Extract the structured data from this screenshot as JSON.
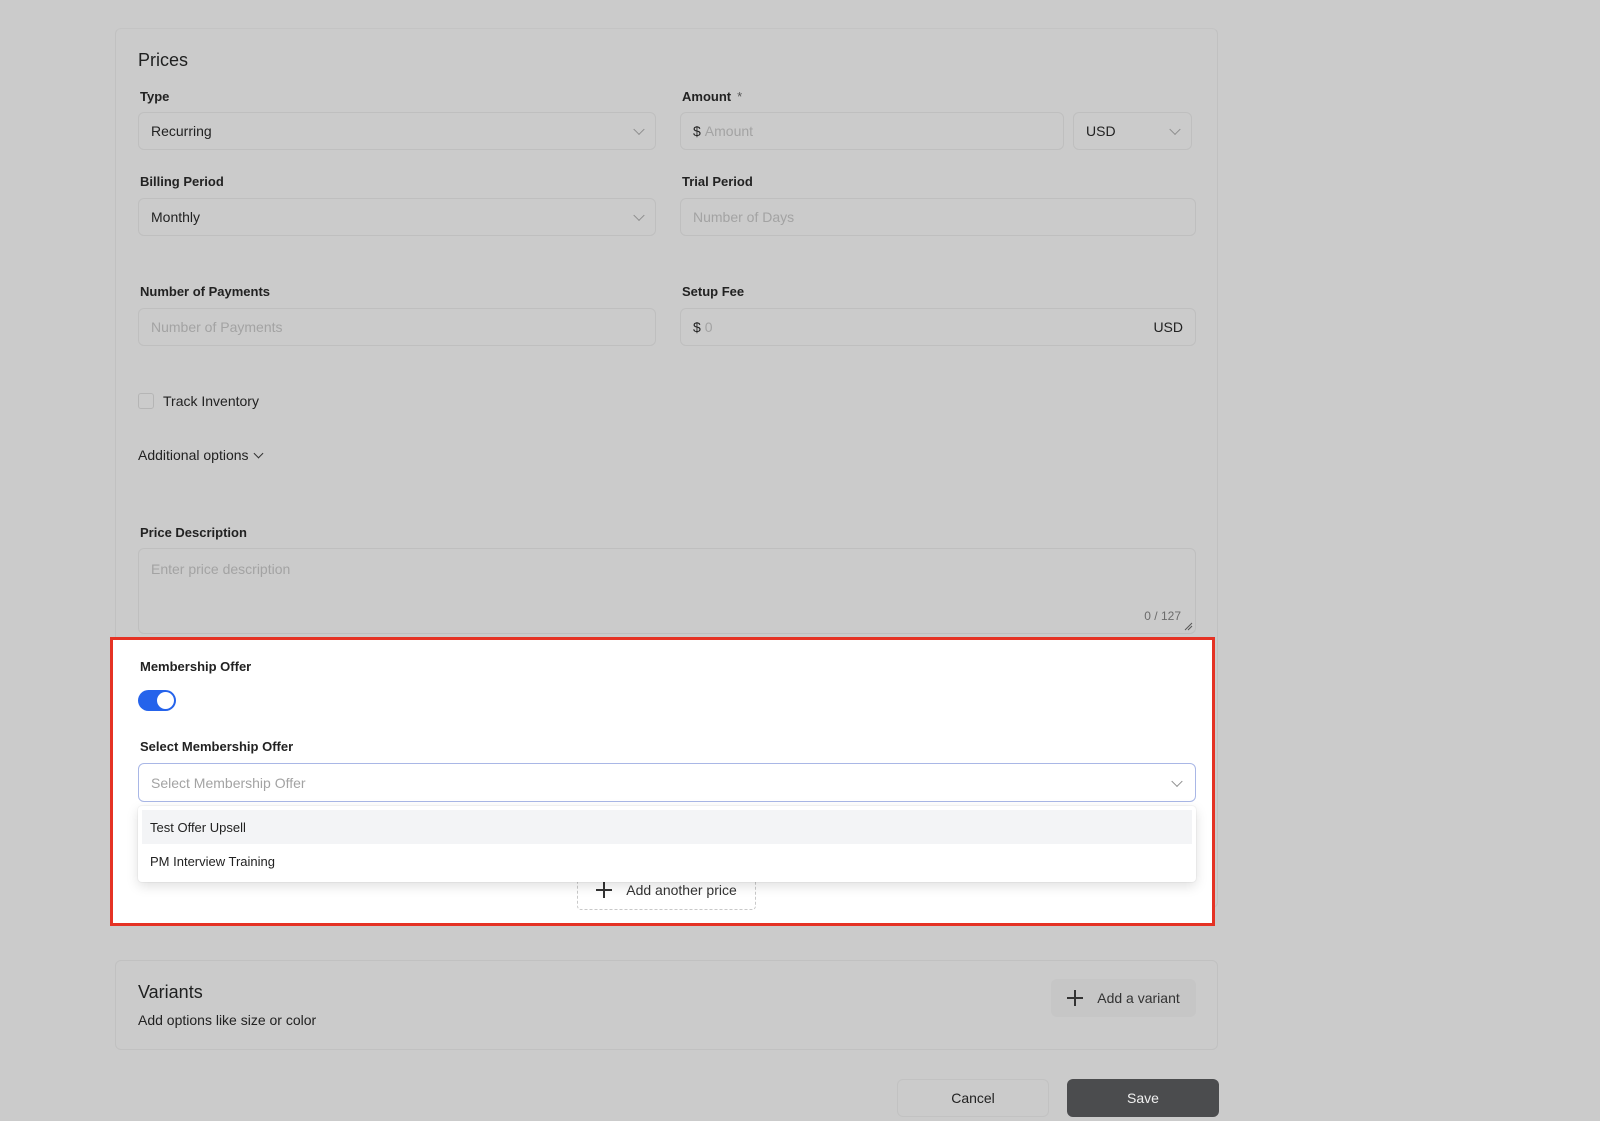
{
  "prices": {
    "title": "Prices",
    "type": {
      "label": "Type",
      "value": "Recurring"
    },
    "amount": {
      "label": "Amount",
      "required_mark": "*",
      "prefix": "$",
      "placeholder": "Amount",
      "currency": "USD"
    },
    "billing_period": {
      "label": "Billing Period",
      "value": "Monthly"
    },
    "trial_period": {
      "label": "Trial Period",
      "placeholder": "Number of Days"
    },
    "num_payments": {
      "label": "Number of Payments",
      "placeholder": "Number of Payments"
    },
    "setup_fee": {
      "label": "Setup Fee",
      "prefix": "$",
      "placeholder": "0",
      "currency": "USD"
    },
    "track_inventory": {
      "label": "Track Inventory",
      "checked": false
    },
    "additional_options": "Additional options",
    "price_description": {
      "label": "Price Description",
      "placeholder": "Enter price description",
      "counter": "0 / 127"
    },
    "membership_offer": {
      "label": "Membership Offer",
      "enabled": true,
      "select_label": "Select Membership Offer",
      "select_placeholder": "Select Membership Offer",
      "options": [
        "Test Offer Upsell",
        "PM Interview Training"
      ]
    },
    "add_another_price": "Add another price"
  },
  "variants": {
    "title": "Variants",
    "subtitle": "Add options like size or color",
    "add_button": "Add a variant"
  },
  "footer": {
    "cancel": "Cancel",
    "save": "Save"
  },
  "colors": {
    "highlight_border": "#e53224",
    "toggle_on": "#2563eb",
    "save_bg": "#4b4c4e"
  }
}
